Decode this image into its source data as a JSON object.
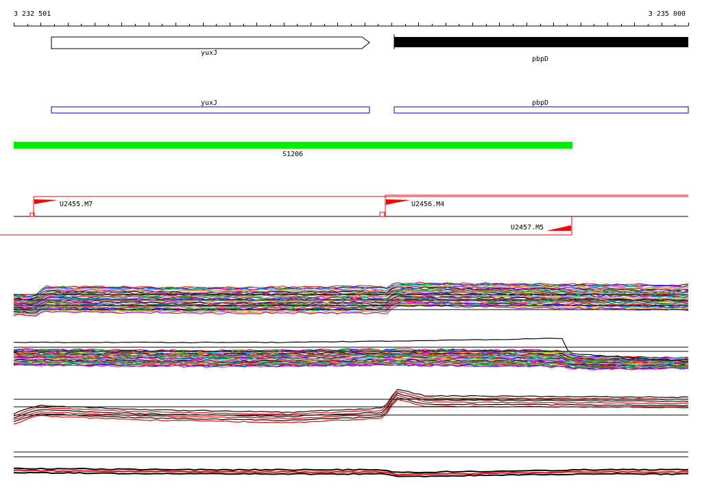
{
  "axis": {
    "start_label": "3 232 501",
    "end_label": "3 235 000",
    "start": 3232501,
    "end": 3235000
  },
  "genes": [
    {
      "name": "yuxJ",
      "style": "outline-arrow",
      "color": "#000000",
      "start": 3232640,
      "end": 3233820
    },
    {
      "name": "pbpD",
      "style": "solid-bar",
      "color": "#000000",
      "start": 3233915,
      "end": 3235000
    }
  ],
  "cds": [
    {
      "name": "yuxJ",
      "color": "#0000aa",
      "start": 3232640,
      "end": 3233820
    },
    {
      "name": "pbpD",
      "color": "#0000aa",
      "start": 3233915,
      "end": 3235000
    }
  ],
  "segment": {
    "name": "S1206",
    "color": "#00ee00",
    "start": 3232501,
    "end": 3234577
  },
  "transcripts": [
    {
      "name": "U2455.M7",
      "start": 3232580,
      "strand": "+",
      "color": "#ff0000"
    },
    {
      "name": "U2456.M4",
      "start": 3233880,
      "strand": "+",
      "color": "#ff0000"
    },
    {
      "name": "U2457.M5",
      "end": 3234577,
      "strand": "-",
      "color": "#ff0000"
    }
  ],
  "colors": {
    "black": "#000000",
    "red": "#ff0000",
    "green": "#00ee00",
    "blue": "#0000aa"
  }
}
